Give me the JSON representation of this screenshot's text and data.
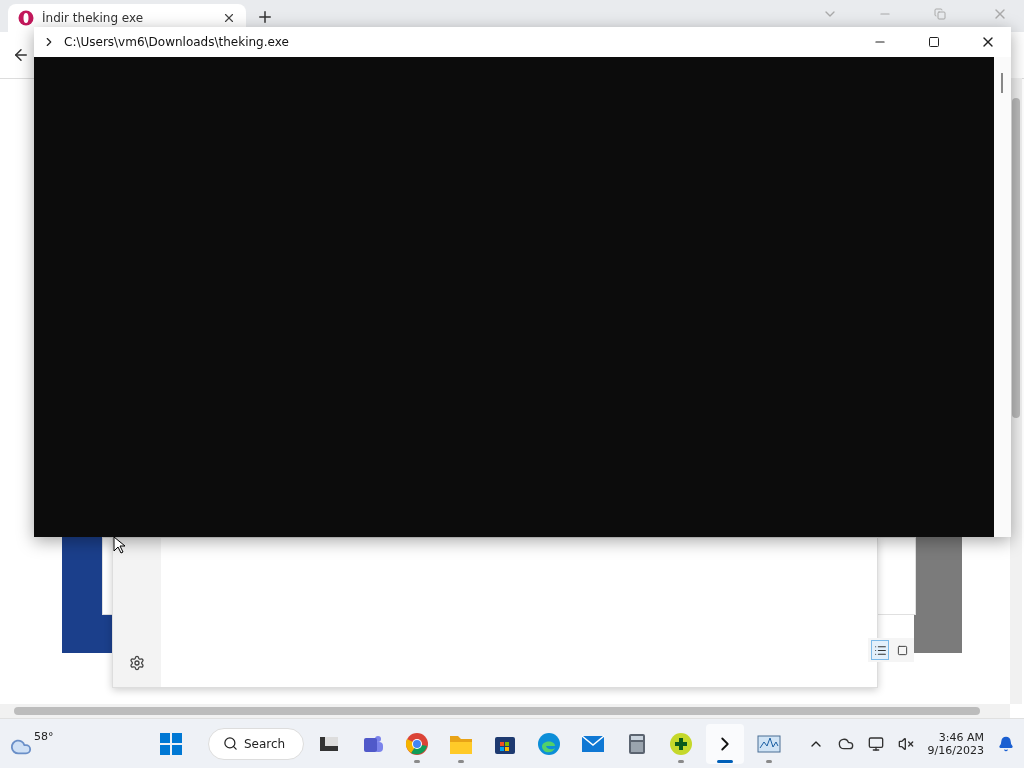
{
  "browser": {
    "tab": {
      "title": "İndir theking exe"
    }
  },
  "view_toggle": [
    {
      "selected": true
    },
    {
      "selected": false
    }
  ],
  "terminal": {
    "title": "C:\\Users\\vm6\\Downloads\\theking.exe"
  },
  "taskbar": {
    "weather": {
      "temperature": "58°"
    },
    "search": {
      "label": "Search"
    },
    "apps": [
      {
        "kind": "task-view",
        "running": false,
        "active": false
      },
      {
        "kind": "teams",
        "running": false,
        "active": false
      },
      {
        "kind": "chrome",
        "running": true,
        "active": false
      },
      {
        "kind": "folder",
        "running": true,
        "active": false
      },
      {
        "kind": "store",
        "running": false,
        "active": false
      },
      {
        "kind": "edge",
        "running": false,
        "active": false
      },
      {
        "kind": "mail",
        "running": false,
        "active": false
      },
      {
        "kind": "calculator",
        "running": false,
        "active": false
      },
      {
        "kind": "plus",
        "running": true,
        "active": false
      },
      {
        "kind": "terminal",
        "running": true,
        "active": true
      },
      {
        "kind": "monitor",
        "running": true,
        "active": false
      }
    ],
    "clock": {
      "time": "3:46 AM",
      "date": "9/16/2023"
    }
  }
}
